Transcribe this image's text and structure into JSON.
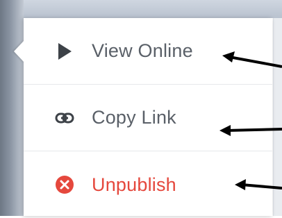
{
  "menu": {
    "items": [
      {
        "label": "View Online",
        "icon": "play-icon"
      },
      {
        "label": "Copy Link",
        "icon": "link-icon"
      },
      {
        "label": "Unpublish",
        "icon": "close-circle-icon"
      }
    ]
  },
  "colors": {
    "text": "#5a6068",
    "icon": "#3d4248",
    "danger": "#e5483d",
    "arrow": "#000000"
  }
}
